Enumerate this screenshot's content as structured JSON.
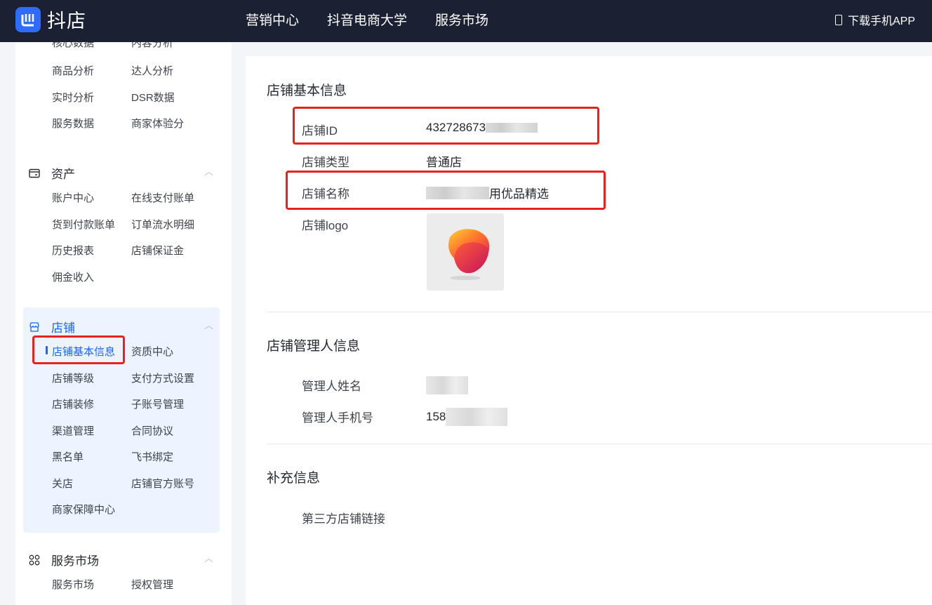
{
  "header": {
    "app_name": "抖店",
    "nav": [
      "营销中心",
      "抖音电商大学",
      "服务市场"
    ],
    "download": "下载手机APP"
  },
  "sidebar": {
    "top_partial": [
      "核心数据",
      "内容分析"
    ],
    "data_rows": [
      [
        "商品分析",
        "达人分析"
      ],
      [
        "实时分析",
        "DSR数据"
      ],
      [
        "服务数据",
        "商家体验分"
      ]
    ],
    "assets": {
      "title": "资产",
      "rows": [
        [
          "账户中心",
          "在线支付账单"
        ],
        [
          "货到付款账单",
          "订单流水明细"
        ],
        [
          "历史报表",
          "店铺保证金"
        ],
        [
          "佣金收入",
          ""
        ]
      ]
    },
    "store": {
      "title": "店铺",
      "active": "店铺基本信息",
      "first_right": "资质中心",
      "rows": [
        [
          "店铺等级",
          "支付方式设置"
        ],
        [
          "店铺装修",
          "子账号管理"
        ],
        [
          "渠道管理",
          "合同协议"
        ],
        [
          "黑名单",
          "飞书绑定"
        ],
        [
          "关店",
          "店铺官方账号"
        ],
        [
          "商家保障中心",
          ""
        ]
      ]
    },
    "market": {
      "title": "服务市场",
      "rows": [
        [
          "服务市场",
          "授权管理"
        ]
      ]
    }
  },
  "main": {
    "basic": {
      "title": "店铺基本信息",
      "id_label": "店铺ID",
      "id_value": "432728673",
      "type_label": "店铺类型",
      "type_value": "普通店",
      "name_label": "店铺名称",
      "name_value": "用优品精选",
      "logo_label": "店铺logo"
    },
    "manager": {
      "title": "店铺管理人信息",
      "name_label": "管理人姓名",
      "phone_label": "管理人手机号",
      "phone_value": "158"
    },
    "extra": {
      "title": "补充信息",
      "link_label": "第三方店铺链接"
    }
  },
  "colors": {
    "topbar": "#1b2132",
    "accent": "#1966ff",
    "highlight_box": "#e8231d",
    "active_panel": "#edf3ff"
  }
}
